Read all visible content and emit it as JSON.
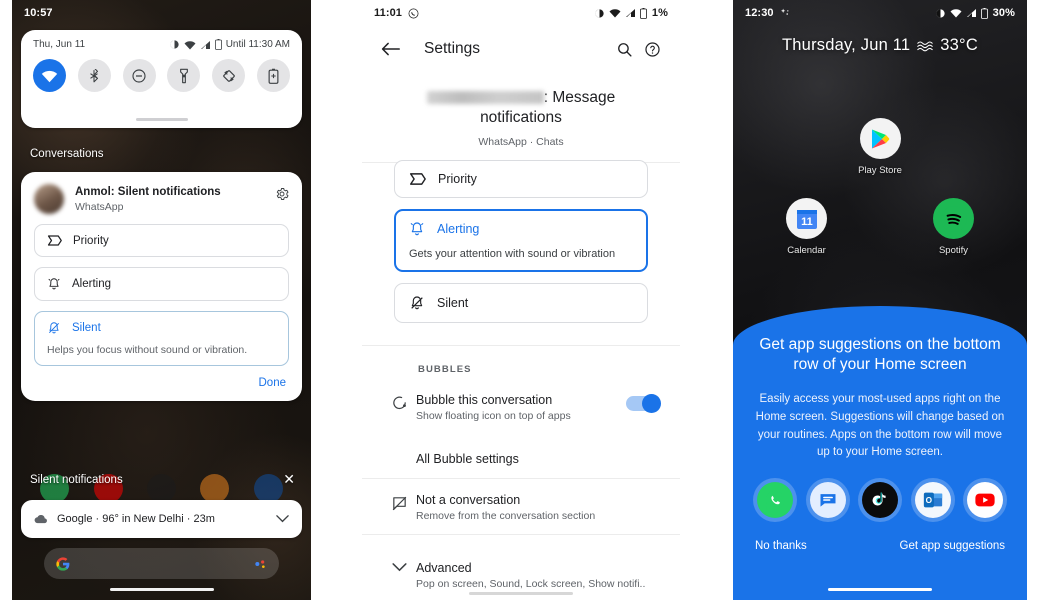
{
  "panel1": {
    "status_bar": {
      "time": "10:57"
    },
    "quick_settings": {
      "date": "Thu, Jun 11",
      "dnd_status": "Until 11:30 AM",
      "tiles": [
        {
          "name": "wifi",
          "label": "Wi-Fi",
          "active": true
        },
        {
          "name": "bluetooth",
          "label": "Bluetooth",
          "active": false
        },
        {
          "name": "do-not-disturb",
          "label": "Do Not Disturb",
          "active": false
        },
        {
          "name": "flashlight",
          "label": "Flashlight",
          "active": false
        },
        {
          "name": "auto-rotate",
          "label": "Auto-rotate",
          "active": false
        },
        {
          "name": "battery-saver",
          "label": "Battery Saver",
          "active": false
        }
      ]
    },
    "conversations_label": "Conversations",
    "notification": {
      "title": "Anmol: Silent notifications",
      "app": "WhatsApp",
      "options": [
        {
          "label": "Priority",
          "icon": "priority-icon",
          "selected": false,
          "desc": ""
        },
        {
          "label": "Alerting",
          "icon": "bell-icon",
          "selected": false,
          "desc": ""
        },
        {
          "label": "Silent",
          "icon": "bell-off-icon",
          "selected": true,
          "desc": "Helps you focus without sound or vibration."
        }
      ],
      "done_label": "Done"
    },
    "silent_label": "Silent notifications",
    "weather": {
      "text": "Google · 96° in New Delhi · 23m"
    }
  },
  "panel2": {
    "status_bar": {
      "time": "11:01",
      "battery": "1%"
    },
    "appbar": {
      "title": "Settings"
    },
    "hero": {
      "redacted": "",
      "title_tail": ": Message",
      "title_line2": "notifications",
      "subtitle": "WhatsApp · Chats"
    },
    "options": [
      {
        "label": "Priority",
        "icon": "priority-icon",
        "selected": false,
        "desc": ""
      },
      {
        "label": "Alerting",
        "icon": "bell-icon",
        "selected": true,
        "desc": "Gets your attention with sound or vibration"
      },
      {
        "label": "Silent",
        "icon": "bell-off-icon",
        "selected": false,
        "desc": ""
      }
    ],
    "bubbles_header": "BUBBLES",
    "rows": [
      {
        "title": "Bubble this conversation",
        "desc": "Show floating icon on top of apps",
        "icon": "bubble-icon",
        "toggle": true
      },
      {
        "title": "All Bubble settings",
        "desc": "",
        "icon": "",
        "toggle": false
      },
      {
        "title": "Not a conversation",
        "desc": "Remove from the conversation section",
        "icon": "not-conversation-icon",
        "toggle": false
      },
      {
        "title": "Advanced",
        "desc": "Pop on screen, Sound, Lock screen, Show notifi..",
        "icon": "chevron-down-icon",
        "toggle": false
      }
    ]
  },
  "panel3": {
    "status_bar": {
      "time": "12:30",
      "battery": "30%"
    },
    "clock": {
      "date": "Thursday, Jun 11",
      "temp": "33°C"
    },
    "apps": [
      {
        "label": "Play Store",
        "icon": "play-store-icon"
      },
      {
        "label": "Calendar",
        "icon": "calendar-icon",
        "day": "11"
      },
      {
        "label": "Spotify",
        "icon": "spotify-icon"
      }
    ],
    "sheet": {
      "heading": "Get app suggestions on the bottom row of your Home screen",
      "body": "Easily access your most-used apps right on the Home screen. Suggestions will change based on your routines. Apps on the bottom row will move up to your Home screen.",
      "suggested_apps": [
        {
          "name": "whatsapp-icon"
        },
        {
          "name": "messages-icon"
        },
        {
          "name": "tiktok-icon"
        },
        {
          "name": "outlook-icon"
        },
        {
          "name": "youtube-icon"
        }
      ],
      "decline_label": "No thanks",
      "accept_label": "Get app suggestions"
    }
  },
  "colors": {
    "accent": "#1a73e8",
    "sheet_bg": "#1a73e8",
    "panel_bg": "#000000"
  }
}
